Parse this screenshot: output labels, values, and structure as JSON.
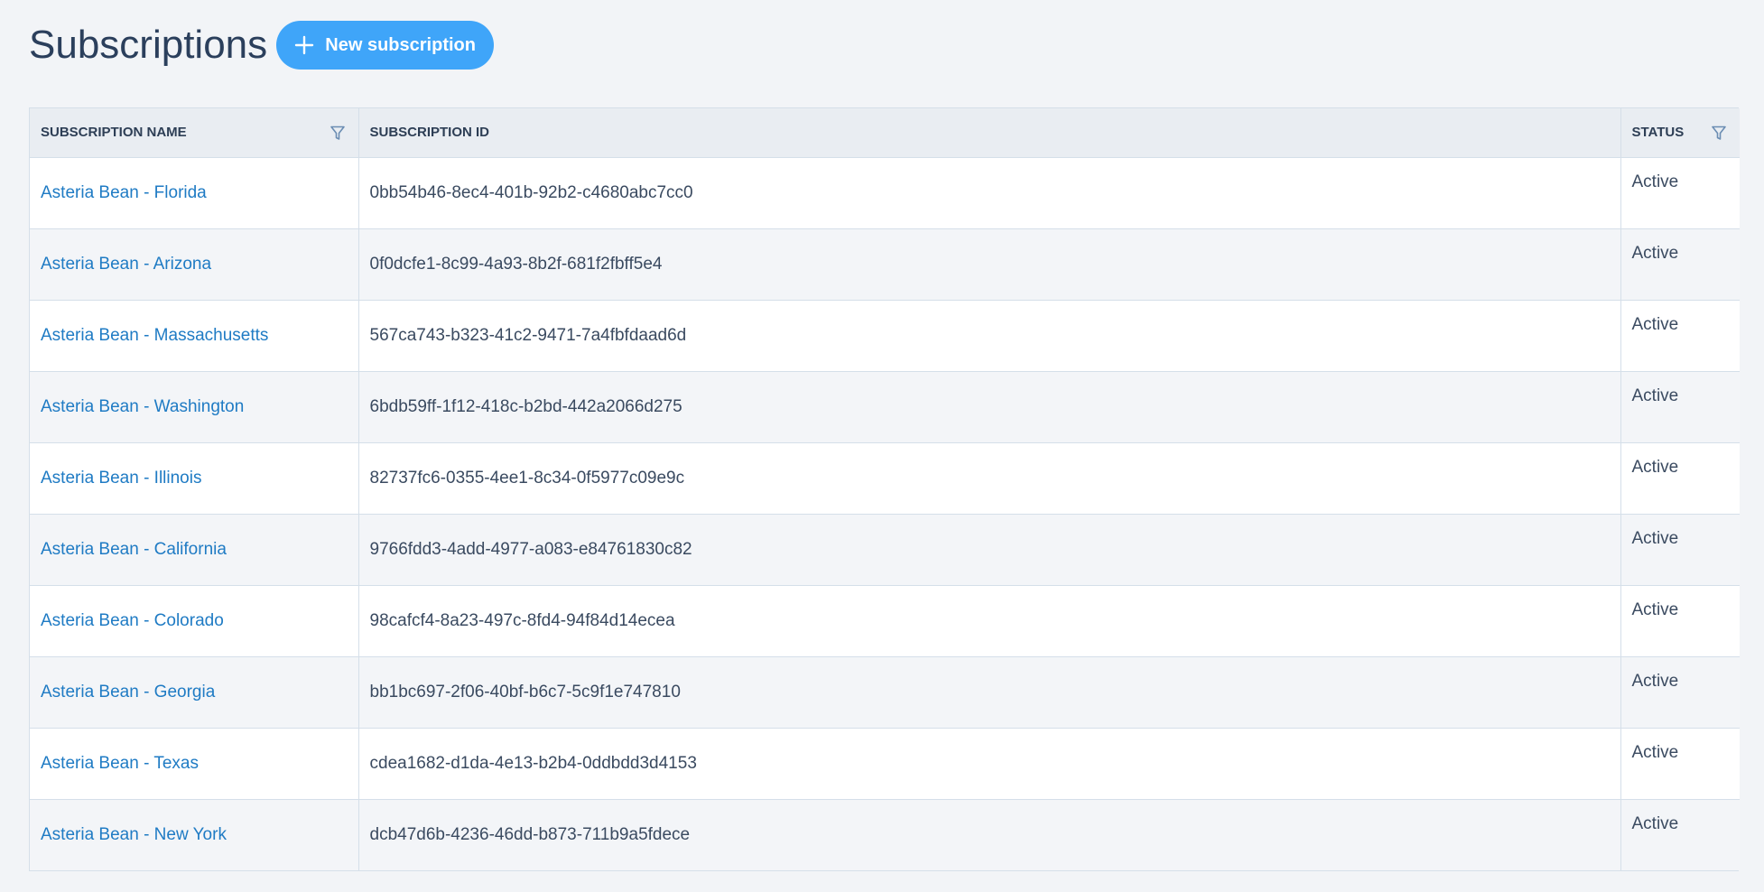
{
  "page": {
    "title": "Subscriptions",
    "new_button": {
      "label": "New subscription",
      "icon": "plus-icon"
    }
  },
  "colors": {
    "accent": "#3fa5f9",
    "link": "#1f7bc4",
    "title": "#2b3f5c",
    "header_bg": "#e9edf2"
  },
  "table": {
    "columns": [
      {
        "label": "Subscription Name",
        "filter": true
      },
      {
        "label": "Subscription ID",
        "filter": false
      },
      {
        "label": "Status",
        "filter": true
      }
    ],
    "rows": [
      {
        "name": "Asteria Bean - Florida",
        "id": "0bb54b46-8ec4-401b-92b2-c4680abc7cc0",
        "status": "Active"
      },
      {
        "name": "Asteria Bean - Arizona",
        "id": "0f0dcfe1-8c99-4a93-8b2f-681f2fbff5e4",
        "status": "Active"
      },
      {
        "name": "Asteria Bean - Massachusetts",
        "id": "567ca743-b323-41c2-9471-7a4fbfdaad6d",
        "status": "Active"
      },
      {
        "name": "Asteria Bean - Washington",
        "id": "6bdb59ff-1f12-418c-b2bd-442a2066d275",
        "status": "Active"
      },
      {
        "name": "Asteria Bean - Illinois",
        "id": "82737fc6-0355-4ee1-8c34-0f5977c09e9c",
        "status": "Active"
      },
      {
        "name": "Asteria Bean - California",
        "id": "9766fdd3-4add-4977-a083-e84761830c82",
        "status": "Active"
      },
      {
        "name": "Asteria Bean - Colorado",
        "id": "98cafcf4-8a23-497c-8fd4-94f84d14ecea",
        "status": "Active"
      },
      {
        "name": "Asteria Bean - Georgia",
        "id": "bb1bc697-2f06-40bf-b6c7-5c9f1e747810",
        "status": "Active"
      },
      {
        "name": "Asteria Bean - Texas",
        "id": "cdea1682-d1da-4e13-b2b4-0ddbdd3d4153",
        "status": "Active"
      },
      {
        "name": "Asteria Bean - New York",
        "id": "dcb47d6b-4236-46dd-b873-711b9a5fdece",
        "status": "Active"
      }
    ]
  }
}
